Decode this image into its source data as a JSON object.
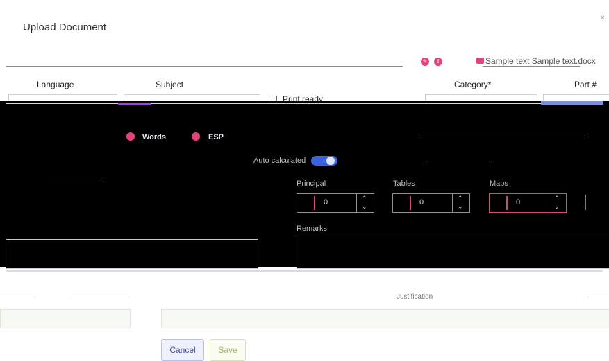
{
  "dialog": {
    "title": "Upload Document",
    "close_icon": "×"
  },
  "header": {
    "file_name": "Sample text Sample text.docx"
  },
  "fields": {
    "language_label": "Language",
    "subject_label": "Subject",
    "print_ready_label": "Print ready",
    "category_label": "Category*",
    "part_label": "Part #"
  },
  "options": {
    "words_label": "Words",
    "esp_label": "ESP",
    "toggle_label": "Auto calculated"
  },
  "counters": [
    {
      "label": "Principal",
      "value": "0"
    },
    {
      "label": "Tables",
      "value": "0"
    },
    {
      "label": "Maps",
      "value": "0"
    }
  ],
  "remarks_label": "Remarks",
  "footer": {
    "justification_label": "Justification"
  },
  "buttons": {
    "cancel": "Cancel",
    "save": "Save"
  },
  "colors": {
    "accent": "#e0447c",
    "toggle": "#3b62e0",
    "cancel_text": "#3f4d9f",
    "save_text": "#a0b85a"
  }
}
